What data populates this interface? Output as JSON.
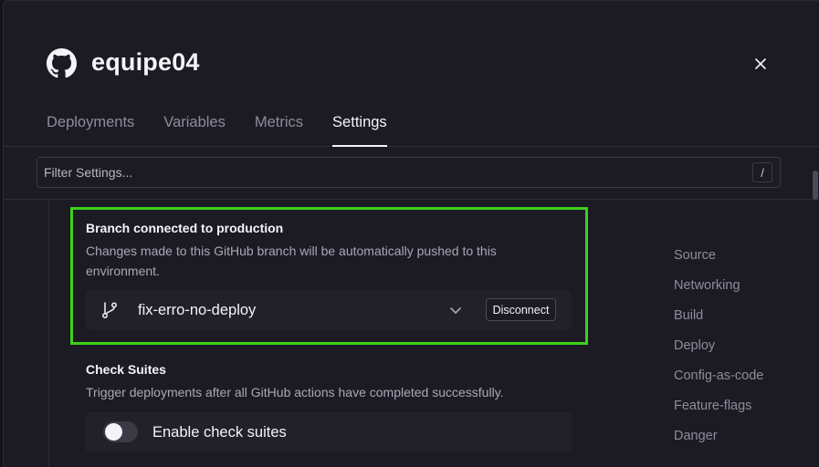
{
  "header": {
    "title": "equipe04",
    "icon": "github-icon",
    "close_icon": "close-icon"
  },
  "tabs": [
    {
      "label": "Deployments",
      "active": false
    },
    {
      "label": "Variables",
      "active": false
    },
    {
      "label": "Metrics",
      "active": false
    },
    {
      "label": "Settings",
      "active": true
    }
  ],
  "filter": {
    "placeholder": "Filter Settings...",
    "shortcut": "/"
  },
  "branch_section": {
    "title": "Branch connected to production",
    "description_line1": "Changes made to this GitHub branch will be automatically pushed to this",
    "description_line2": "environment.",
    "branch_name": "fix-erro-no-deploy",
    "disconnect_label": "Disconnect"
  },
  "check_suites": {
    "title": "Check Suites",
    "description": "Trigger deployments after all GitHub actions have completed successfully.",
    "toggle_label": "Enable check suites",
    "enabled": false
  },
  "side_nav": {
    "items": [
      "Source",
      "Networking",
      "Build",
      "Deploy",
      "Config-as-code",
      "Feature-flags",
      "Danger"
    ]
  },
  "colors": {
    "highlight": "#3ed11a",
    "background": "#1c1b24",
    "row": "#222129"
  }
}
